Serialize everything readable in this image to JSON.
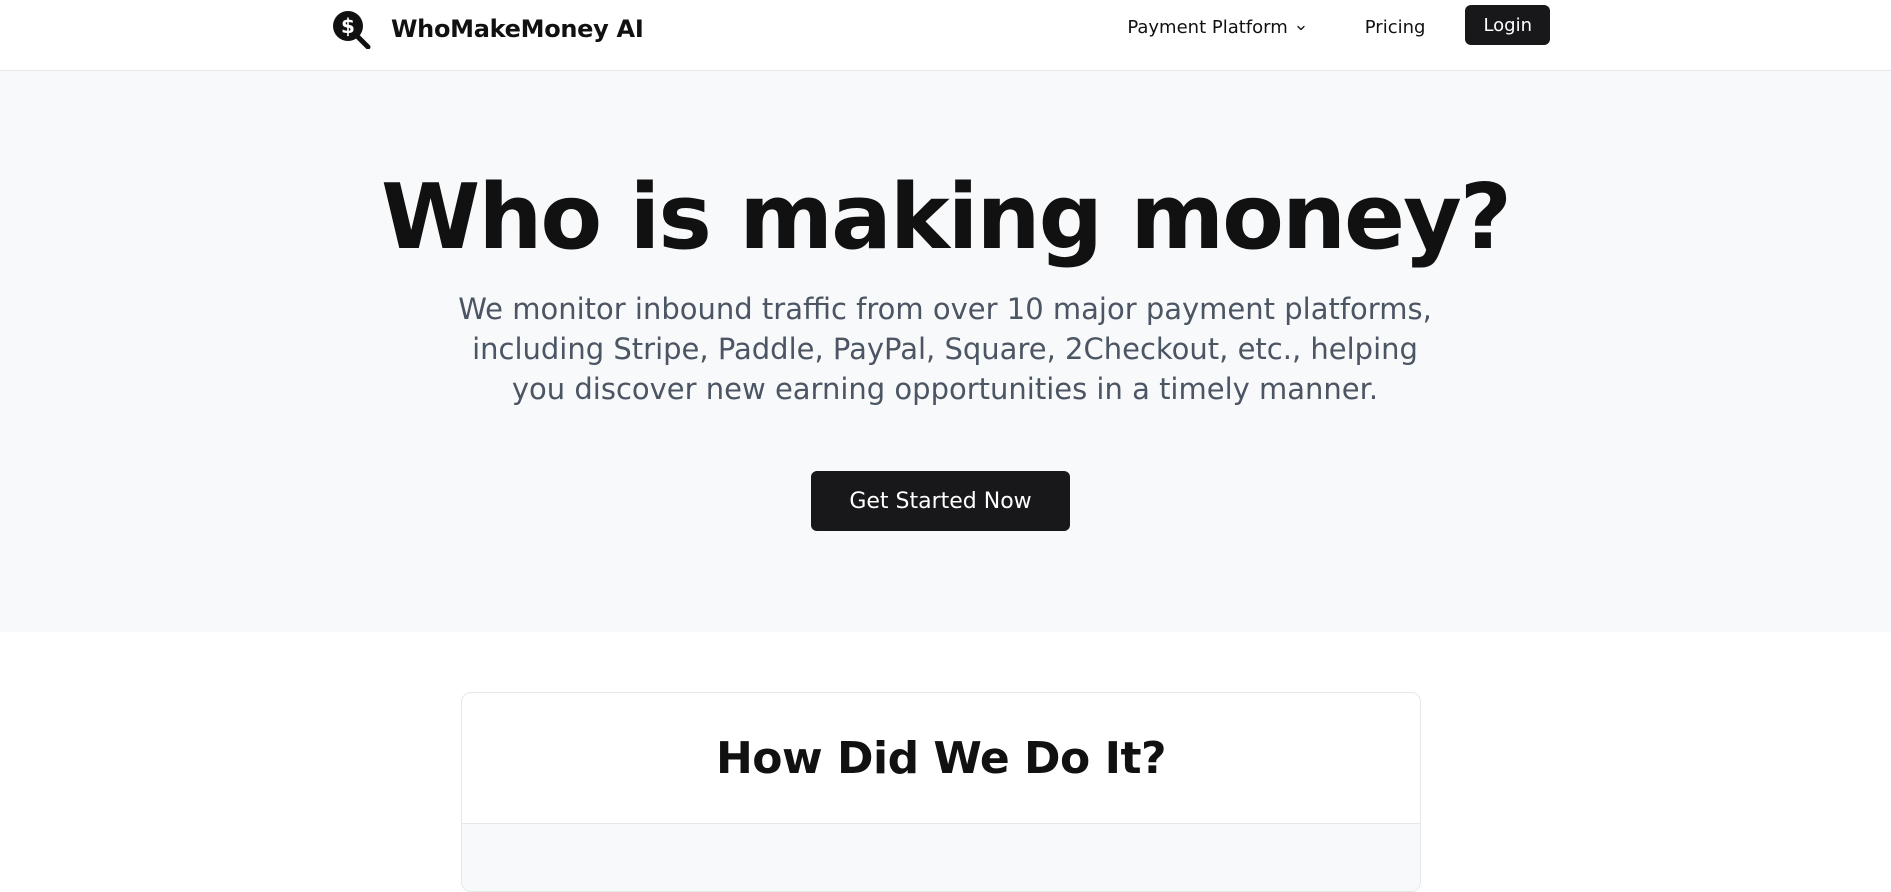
{
  "header": {
    "brand_name": "WhoMakeMoney AI",
    "logo_icon": "dollar-magnifier-icon",
    "nav": {
      "payment_platform_label": "Payment Platform",
      "pricing_label": "Pricing",
      "login_label": "Login"
    }
  },
  "hero": {
    "title": "Who is making money?",
    "subtitle": "We monitor inbound traffic from over 10 major payment platforms, including Stripe, Paddle, PayPal, Square, 2Checkout, etc., helping you discover new earning opportunities in a timely manner.",
    "cta_label": "Get Started Now"
  },
  "how": {
    "title": "How Did We Do It?"
  },
  "colors": {
    "primary_dark": "#18181b",
    "hero_bg": "#f8f9fa",
    "subtitle_text": "#4b5563"
  }
}
